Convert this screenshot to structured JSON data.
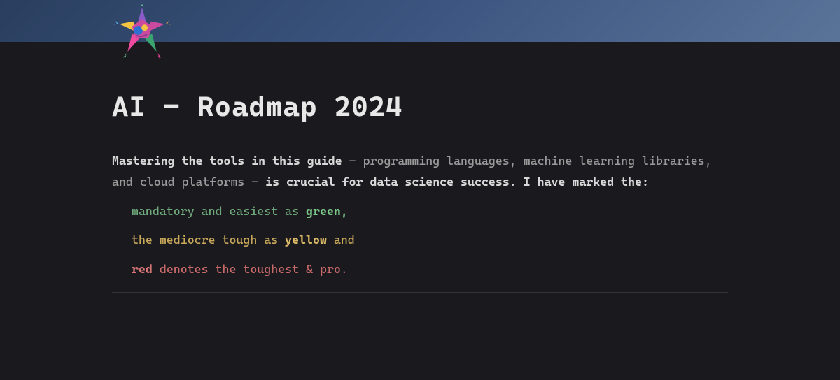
{
  "title": "AI - Roadmap 2024",
  "intro": {
    "bold1": "Mastering the tools in this guide",
    "plain1": " - programming languages, machine learning libraries, and cloud platforms - ",
    "bold2": "is crucial for data science success. I have marked the:"
  },
  "bullets": {
    "green": {
      "pre": "mandatory and easiest as ",
      "bold": "green,",
      "post": ""
    },
    "yellow": {
      "pre": "the mediocre tough as ",
      "bold": "yellow",
      "post": " and"
    },
    "red": {
      "pre": "",
      "bold": "red",
      "post": " denotes the toughest & pro."
    }
  }
}
